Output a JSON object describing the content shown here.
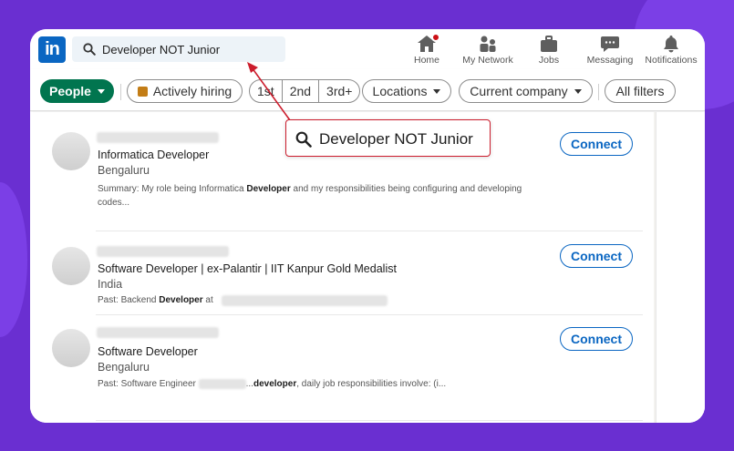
{
  "search": {
    "query": "Developer NOT Junior"
  },
  "nav": [
    {
      "label": "Home",
      "icon": "home-icon"
    },
    {
      "label": "My Network",
      "icon": "network-icon"
    },
    {
      "label": "Jobs",
      "icon": "briefcase-icon"
    },
    {
      "label": "Messaging",
      "icon": "messaging-icon"
    },
    {
      "label": "Notifications",
      "icon": "bell-icon"
    }
  ],
  "filters": {
    "people": "People",
    "actively_hiring": "Actively hiring",
    "connections": [
      "1st",
      "2nd",
      "3rd+"
    ],
    "locations": "Locations",
    "current_company": "Current company",
    "all_filters": "All filters"
  },
  "results": [
    {
      "title": "Informatica Developer",
      "location": "Bengaluru",
      "summary_prefix": "Summary: My role being Informatica ",
      "summary_bold": "Developer",
      "summary_suffix": " and my responsibilities being configuring and developing codes...",
      "action": "Connect"
    },
    {
      "title": "Software Developer | ex-Palantir | IIT Kanpur Gold Medalist",
      "location": "India",
      "summary_prefix": "Past: Backend ",
      "summary_bold": "Developer",
      "summary_suffix": " at",
      "action": "Connect"
    },
    {
      "title": "Software Developer",
      "location": "Bengaluru",
      "summary_prefix": "Past: Software Engineer ",
      "summary_bold": "developer",
      "summary_suffix": ", daily job responsibilities involve: (i...",
      "action": "Connect"
    }
  ],
  "callout": {
    "text": "Developer NOT Junior"
  },
  "colors": {
    "background": "#6a2fd1",
    "brand": "#0a66c2",
    "people_pill": "#01754f",
    "callout_border": "#cc1d2d"
  }
}
